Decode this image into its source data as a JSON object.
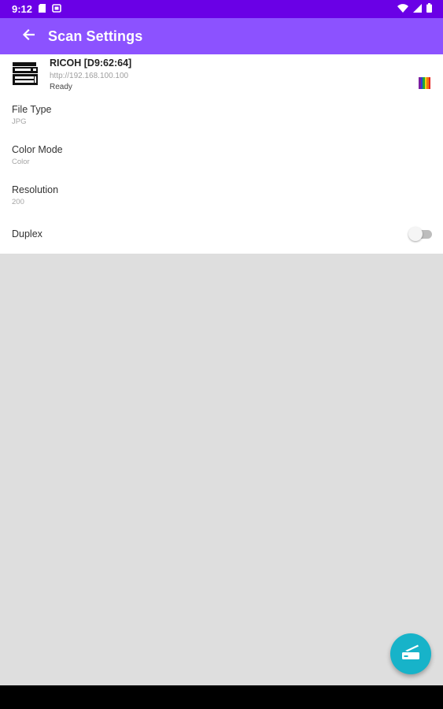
{
  "status_bar": {
    "time": "9:12",
    "icons": [
      "sd-card-icon",
      "screenshot-icon",
      "wifi-icon",
      "signal-icon",
      "battery-icon"
    ]
  },
  "app_bar": {
    "title": "Scan Settings",
    "back_icon": "arrow-back-icon"
  },
  "printer": {
    "name": "RICOH [D9:62:64]",
    "url": "http://192.168.100.100",
    "status": "Ready",
    "icon": "printer-icon",
    "color_icon": "color-spectrum-icon"
  },
  "settings": [
    {
      "label": "File Type",
      "value": "JPG"
    },
    {
      "label": "Color Mode",
      "value": "Color"
    },
    {
      "label": "Resolution",
      "value": "200"
    }
  ],
  "duplex": {
    "label": "Duplex",
    "enabled": false
  },
  "fab": {
    "icon": "scanner-icon"
  },
  "colors": {
    "status_bar": "#6a00e6",
    "app_bar": "#8c52ff",
    "fab": "#17b3c9",
    "background": "#dedede",
    "panel": "#ffffff"
  }
}
